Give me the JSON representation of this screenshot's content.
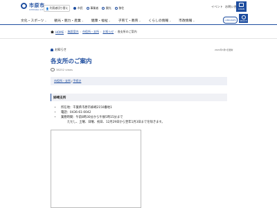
{
  "header": {
    "logo_text": "市原市",
    "logo_sub": "ICHIHARA CITY",
    "switch_label": "利用者切り替え",
    "radio": [
      "市民",
      "事業者",
      "観光",
      "移住"
    ],
    "event": "イベント",
    "contact": "お問い合わせ",
    "login": "LOGIN",
    "languages": "LANGUAGES",
    "search": "SEARCH"
  },
  "nav": [
    "文化・スポーツ",
    "観光・魅力・産業",
    "健康・福祉",
    "子育て・教育",
    "くらしの情報",
    "市政情報"
  ],
  "breadcrumb": [
    "HOME",
    "施設案内",
    "市役所・支所",
    "お知らせ",
    "各支所のご案内"
  ],
  "notice_label": "お知らせ",
  "updated": "2021年3月5日更新",
  "title": "各支所のご案内",
  "views": "38252 views",
  "links": [
    "市役所・支所",
    "手続き"
  ],
  "section": {
    "heading": "姉崎支所",
    "items": [
      "所在地：千葉県市原市姉崎2150番地1",
      "電話：0436-61-0042",
      "業務時間：午前8時30分から午後5時15分まで",
      "ただし、土曜、日曜、祝日、12月29日から翌年1月3日までを除きます。"
    ]
  }
}
